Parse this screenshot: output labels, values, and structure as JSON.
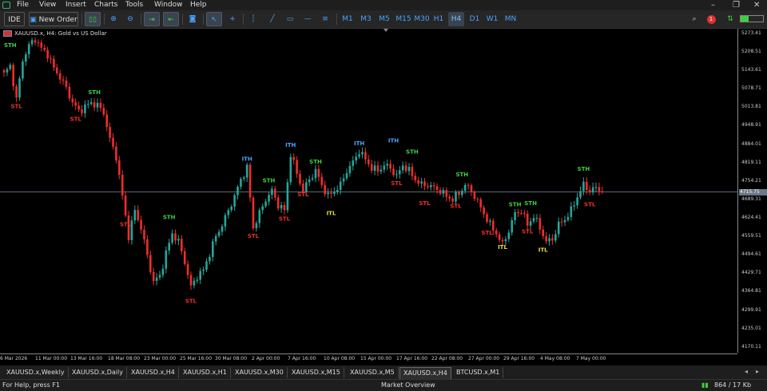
{
  "menu": {
    "items": [
      "File",
      "View",
      "Insert",
      "Charts",
      "Tools",
      "Window",
      "Help"
    ]
  },
  "toolbar": {
    "ide_label": "IDE",
    "new_order_label": "New Order",
    "timeframes": [
      "M1",
      "M3",
      "M5",
      "M15",
      "M30",
      "H1",
      "H4",
      "D1",
      "W1",
      "MN"
    ],
    "active_timeframe": "H4",
    "notification_count": "1"
  },
  "chart": {
    "title": "XAUUSD.x, H4:  Gold vs US Dollar",
    "current_price": "4715.75",
    "price_ticks": [
      "5273.41",
      "5208.51",
      "5143.61",
      "5078.71",
      "5013.81",
      "4948.91",
      "4884.01",
      "4819.11",
      "4754.21",
      "4689.31",
      "4624.41",
      "4559.51",
      "4494.61",
      "4429.71",
      "4364.81",
      "4299.91",
      "4235.01",
      "4170.11"
    ],
    "time_ticks": [
      "6 Mar 2026",
      "11 Mar 00:00",
      "13 Mar 16:00",
      "18 Mar 08:00",
      "23 Mar 00:00",
      "25 Mar 16:00",
      "30 Mar 08:00",
      "2 Apr 00:00",
      "7 Apr 16:00",
      "10 Apr 08:00",
      "15 Apr 00:00",
      "17 Apr 16:00",
      "22 Apr 08:00",
      "27 Apr 00:00",
      "29 Apr 16:00",
      "4 May 08:00",
      "7 May 00:00"
    ],
    "labels": [
      {
        "text": "STH",
        "kind": "sth",
        "bar": 2,
        "price": 5225
      },
      {
        "text": "STL",
        "kind": "stl",
        "bar": 4,
        "price": 5010
      },
      {
        "text": "STL",
        "kind": "stl",
        "bar": 23,
        "price": 4965
      },
      {
        "text": "STH",
        "kind": "sth",
        "bar": 29,
        "price": 5060
      },
      {
        "text": "STL",
        "kind": "stl",
        "bar": 39,
        "price": 4595
      },
      {
        "text": "STH",
        "kind": "sth",
        "bar": 53,
        "price": 4620
      },
      {
        "text": "STL",
        "kind": "stl",
        "bar": 60,
        "price": 4325
      },
      {
        "text": "ITH",
        "kind": "ith",
        "bar": 78,
        "price": 4825
      },
      {
        "text": "STL",
        "kind": "stl",
        "bar": 80,
        "price": 4555
      },
      {
        "text": "STH",
        "kind": "sth",
        "bar": 85,
        "price": 4750
      },
      {
        "text": "STL",
        "kind": "stl",
        "bar": 90,
        "price": 4615
      },
      {
        "text": "ITH",
        "kind": "ith",
        "bar": 92,
        "price": 4875
      },
      {
        "text": "STL",
        "kind": "stl",
        "bar": 96,
        "price": 4700
      },
      {
        "text": "STH",
        "kind": "sth",
        "bar": 100,
        "price": 4815
      },
      {
        "text": "ITL",
        "kind": "itl",
        "bar": 105,
        "price": 4635
      },
      {
        "text": "ITH",
        "kind": "ith",
        "bar": 114,
        "price": 4880
      },
      {
        "text": "ITH",
        "kind": "ith",
        "bar": 125,
        "price": 4890
      },
      {
        "text": "STL",
        "kind": "stl",
        "bar": 126,
        "price": 4740
      },
      {
        "text": "STH",
        "kind": "sth",
        "bar": 131,
        "price": 4850
      },
      {
        "text": "STL",
        "kind": "stl",
        "bar": 135,
        "price": 4670
      },
      {
        "text": "STL",
        "kind": "stl",
        "bar": 145,
        "price": 4660
      },
      {
        "text": "STH",
        "kind": "sth",
        "bar": 147,
        "price": 4770
      },
      {
        "text": "STL",
        "kind": "stl",
        "bar": 155,
        "price": 4565
      },
      {
        "text": "ITL",
        "kind": "itl",
        "bar": 160,
        "price": 4515
      },
      {
        "text": "STH",
        "kind": "sth",
        "bar": 164,
        "price": 4665
      },
      {
        "text": "STL",
        "kind": "stl",
        "bar": 168,
        "price": 4570
      },
      {
        "text": "STH",
        "kind": "sth",
        "bar": 169,
        "price": 4670
      },
      {
        "text": "ITL",
        "kind": "itl",
        "bar": 173,
        "price": 4505
      },
      {
        "text": "STH",
        "kind": "sth",
        "bar": 186,
        "price": 4790
      },
      {
        "text": "STL",
        "kind": "stl",
        "bar": 188,
        "price": 4665
      }
    ]
  },
  "chart_data": {
    "type": "candlestick",
    "symbol": "XAUUSD.x",
    "timeframe": "H4",
    "ylim": [
      4150,
      5290
    ],
    "current_price": 4715.75,
    "up_color": "#26a69a",
    "down_color": "#ef2d2d",
    "close_path": [
      [
        0,
        5130
      ],
      [
        2,
        5160
      ],
      [
        4,
        5040
      ],
      [
        6,
        5180
      ],
      [
        8,
        5230
      ],
      [
        10,
        5255
      ],
      [
        12,
        5220
      ],
      [
        14,
        5200
      ],
      [
        16,
        5150
      ],
      [
        18,
        5120
      ],
      [
        20,
        5080
      ],
      [
        22,
        5030
      ],
      [
        24,
        5000
      ],
      [
        26,
        5015
      ],
      [
        28,
        5030
      ],
      [
        30,
        5020
      ],
      [
        32,
        4995
      ],
      [
        34,
        4900
      ],
      [
        36,
        4840
      ],
      [
        38,
        4700
      ],
      [
        40,
        4560
      ],
      [
        42,
        4650
      ],
      [
        44,
        4590
      ],
      [
        46,
        4490
      ],
      [
        48,
        4400
      ],
      [
        50,
        4420
      ],
      [
        52,
        4500
      ],
      [
        54,
        4570
      ],
      [
        56,
        4540
      ],
      [
        58,
        4470
      ],
      [
        60,
        4380
      ],
      [
        62,
        4420
      ],
      [
        64,
        4440
      ],
      [
        66,
        4500
      ],
      [
        68,
        4560
      ],
      [
        70,
        4600
      ],
      [
        72,
        4650
      ],
      [
        74,
        4700
      ],
      [
        76,
        4760
      ],
      [
        78,
        4800
      ],
      [
        80,
        4590
      ],
      [
        82,
        4640
      ],
      [
        84,
        4690
      ],
      [
        86,
        4720
      ],
      [
        88,
        4670
      ],
      [
        90,
        4650
      ],
      [
        92,
        4850
      ],
      [
        94,
        4780
      ],
      [
        96,
        4720
      ],
      [
        98,
        4760
      ],
      [
        100,
        4790
      ],
      [
        102,
        4740
      ],
      [
        104,
        4700
      ],
      [
        106,
        4720
      ],
      [
        108,
        4740
      ],
      [
        110,
        4790
      ],
      [
        112,
        4820
      ],
      [
        114,
        4860
      ],
      [
        116,
        4830
      ],
      [
        118,
        4800
      ],
      [
        120,
        4790
      ],
      [
        122,
        4810
      ],
      [
        124,
        4800
      ],
      [
        126,
        4770
      ],
      [
        128,
        4810
      ],
      [
        130,
        4790
      ],
      [
        132,
        4760
      ],
      [
        134,
        4740
      ],
      [
        136,
        4740
      ],
      [
        138,
        4730
      ],
      [
        140,
        4720
      ],
      [
        142,
        4700
      ],
      [
        144,
        4690
      ],
      [
        146,
        4710
      ],
      [
        148,
        4740
      ],
      [
        150,
        4720
      ],
      [
        152,
        4680
      ],
      [
        154,
        4640
      ],
      [
        156,
        4600
      ],
      [
        158,
        4570
      ],
      [
        160,
        4530
      ],
      [
        162,
        4580
      ],
      [
        164,
        4640
      ],
      [
        166,
        4650
      ],
      [
        168,
        4600
      ],
      [
        170,
        4630
      ],
      [
        172,
        4590
      ],
      [
        174,
        4540
      ],
      [
        176,
        4550
      ],
      [
        178,
        4600
      ],
      [
        180,
        4620
      ],
      [
        182,
        4650
      ],
      [
        184,
        4700
      ],
      [
        186,
        4740
      ],
      [
        188,
        4720
      ],
      [
        190,
        4730
      ],
      [
        192,
        4715.75
      ]
    ]
  },
  "tabs": {
    "items": [
      "XAUUSD.x,Weekly",
      "XAUUSD.x,Daily",
      "XAUUSD.x,H4",
      "XAUUSD.x,H1",
      "XAUUSD.x,M30",
      "XAUUSD.x,M15",
      "XAUUSD.x,M5",
      "XAUUSD.x,H4",
      "BTCUSD.x,M1"
    ],
    "active_index": 7
  },
  "status": {
    "help_text": "For Help, press F1",
    "market_text": "Market Overview",
    "traffic_text": "864 / 17 Kb"
  },
  "colors": {
    "bg": "#000000",
    "sth": "#3cd13c",
    "stl": "#ef2d2d",
    "ith": "#4aa3ff",
    "itl": "#e6e23a",
    "accent": "#4aa3ff"
  }
}
